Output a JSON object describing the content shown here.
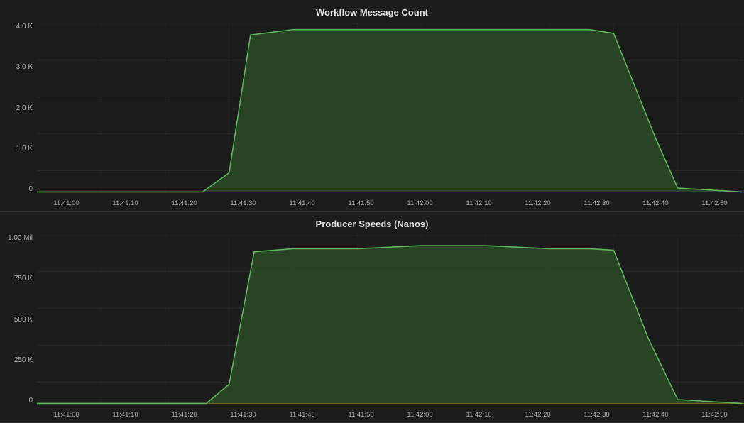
{
  "charts": [
    {
      "id": "workflow-message-count",
      "title": "Workflow Message Count",
      "yLabels": [
        "4.0 K",
        "3.0 K",
        "2.0 K",
        "1.0 K",
        "0"
      ],
      "xLabels": [
        "11:41:00",
        "11:41:10",
        "11:41:20",
        "11:41:30",
        "11:41:40",
        "11:41:50",
        "11:42:00",
        "11:42:10",
        "11:42:20",
        "11:42:30",
        "11:42:40",
        "11:42:50"
      ],
      "color": "#4caf50",
      "fillColor": "rgba(45, 80, 45, 0.7)"
    },
    {
      "id": "producer-speeds",
      "title": "Producer Speeds (Nanos)",
      "yLabels": [
        "1.00 Mil",
        "750 K",
        "500 K",
        "250 K",
        "0"
      ],
      "xLabels": [
        "11:41:00",
        "11:41:10",
        "11:41:20",
        "11:41:30",
        "11:41:40",
        "11:41:50",
        "11:42:00",
        "11:42:10",
        "11:42:20",
        "11:42:30",
        "11:42:40",
        "11:42:50"
      ],
      "color": "#4caf50",
      "fillColor": "rgba(45, 80, 45, 0.7)"
    }
  ]
}
